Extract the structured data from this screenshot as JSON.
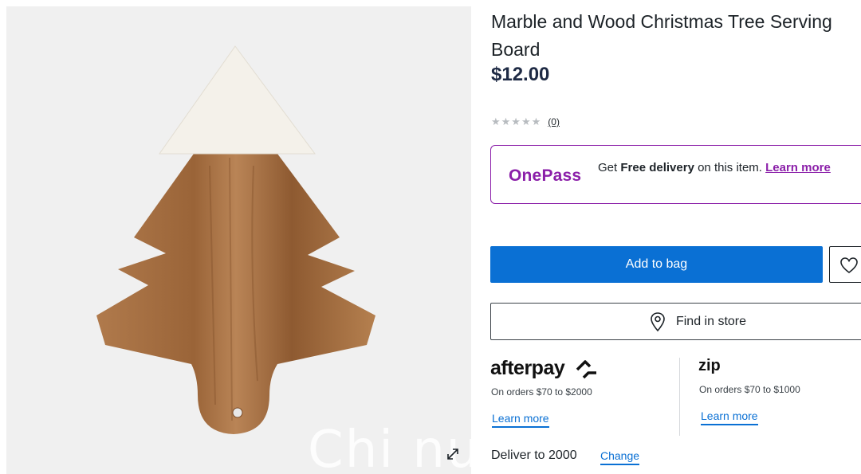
{
  "product": {
    "title": "Marble and Wood Christmas Tree Serving Board",
    "price": "$12.00",
    "rating_stars": "★★★★★",
    "review_count": "(0)"
  },
  "onepass": {
    "logo": "OnePass",
    "text_prefix": "Get ",
    "text_bold": "Free delivery",
    "text_suffix": " on this item. ",
    "learn_more": "Learn more"
  },
  "actions": {
    "add_to_bag": "Add to bag",
    "find_in_store": "Find in store"
  },
  "afterpay": {
    "logo": "afterpay",
    "note": "On orders $70 to $2000",
    "learn_more": "Learn more"
  },
  "zip": {
    "logo": "zip",
    "note": "On orders $70 to $1000",
    "learn_more": "Learn more"
  },
  "delivery": {
    "text": "Deliver to 2000",
    "change": "Change"
  },
  "gallery": {
    "watermark": "Chi nu"
  },
  "colors": {
    "brand_blue": "#0a70d4",
    "onepass_purple": "#8b1fa9",
    "gallery_bg": "#f0f0f0"
  }
}
